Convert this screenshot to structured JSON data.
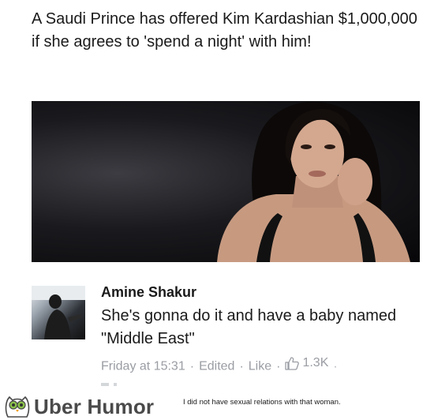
{
  "post": {
    "headline": "A Saudi Prince has offered Kim Kardashian $1,000,000 if she agrees to 'spend a night' with him!"
  },
  "comment": {
    "author": "Amine Shakur",
    "text": "She's gonna do it and have a baby named \"Middle East\"",
    "timestamp": "Friday at 15:31",
    "edited_label": "Edited",
    "like_label": "Like",
    "like_count": "1.3K",
    "separator": "·"
  },
  "footer": {
    "brand": "Uber Humor",
    "caption": "I did not have sexual relations with that woman."
  },
  "icons": {
    "like": "thumbs-up-icon",
    "brand": "owl-logo-icon"
  }
}
